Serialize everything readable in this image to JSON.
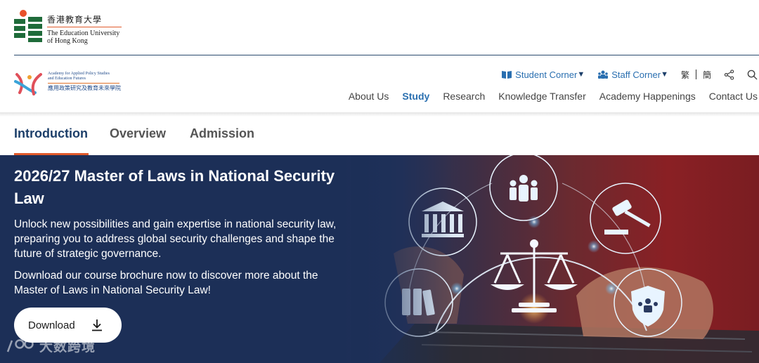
{
  "university": {
    "name_cn": "香港教育大學",
    "name_en_line1": "The Education University",
    "name_en_line2": "of Hong Kong"
  },
  "academy": {
    "name_en_line1": "Academy for Applied Policy Studies",
    "name_en_line2": "and Education Futures",
    "name_cn": "應用政策研究及教育未來學院"
  },
  "utility": {
    "student_corner": "Student Corner",
    "staff_corner": "Staff Corner",
    "lang_trad": "繁",
    "lang_simp": "簡",
    "share_icon": "share-icon",
    "search_icon": "search-icon"
  },
  "nav": {
    "items": [
      "About Us",
      "Study",
      "Research",
      "Knowledge Transfer",
      "Academy Happenings",
      "Contact Us"
    ],
    "active": "Study"
  },
  "tabs": {
    "items": [
      "Introduction",
      "Overview",
      "Admission"
    ],
    "active": "Introduction"
  },
  "hero": {
    "title": "2026/27 Master of Laws in National Security Law",
    "paragraph1": "Unlock new possibilities and gain expertise in national security law, preparing you to address global security challenges and shape the future of strategic governance.",
    "paragraph2": "Download our course brochure now to discover more about the Master of Laws in National Security Law!",
    "download_label": "Download"
  },
  "watermark": {
    "text": "大数跨境"
  },
  "colors": {
    "accent_blue": "#2a6fb0",
    "navy": "#1d3f6a",
    "accent_orange": "#e05a2b",
    "hero_bg": "#1c2f57"
  }
}
